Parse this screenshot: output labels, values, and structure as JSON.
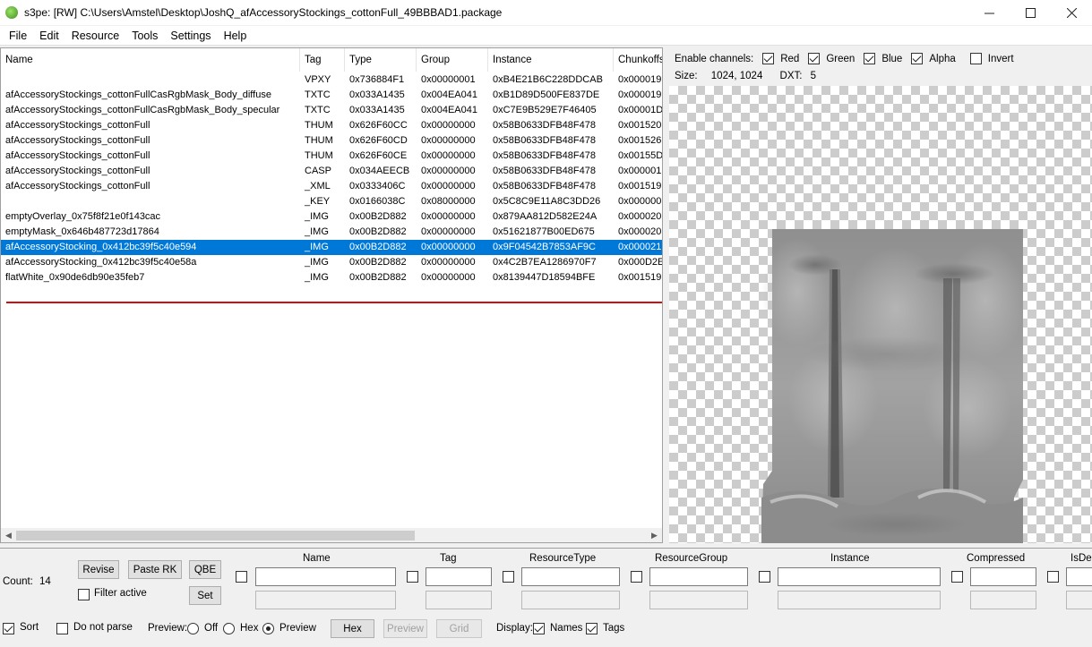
{
  "window": {
    "title": "s3pe: [RW] C:\\Users\\Amstel\\Desktop\\JoshQ_afAccessoryStockings_cottonFull_49BBBAD1.package"
  },
  "menu": [
    "File",
    "Edit",
    "Resource",
    "Tools",
    "Settings",
    "Help"
  ],
  "list": {
    "columns": [
      "Name",
      "Tag",
      "Type",
      "Group",
      "Instance",
      "Chunkoffs"
    ],
    "rows": [
      {
        "name": "",
        "tag": "VPXY",
        "type": "0x736884F1",
        "group": "0x00000001",
        "instance": "0xB4E21B6C228DDCAB",
        "chunk": "0x000019"
      },
      {
        "name": "afAccessoryStockings_cottonFullCasRgbMask_Body_diffuse",
        "tag": "TXTC",
        "type": "0x033A1435",
        "group": "0x004EA041",
        "instance": "0xB1D89D500FE837DE",
        "chunk": "0x000019"
      },
      {
        "name": "afAccessoryStockings_cottonFullCasRgbMask_Body_specular",
        "tag": "TXTC",
        "type": "0x033A1435",
        "group": "0x004EA041",
        "instance": "0xC7E9B529E7F46405",
        "chunk": "0x00001D"
      },
      {
        "name": "afAccessoryStockings_cottonFull",
        "tag": "THUM",
        "type": "0x626F60CC",
        "group": "0x00000000",
        "instance": "0x58B0633DFB48F478",
        "chunk": "0x001520"
      },
      {
        "name": "afAccessoryStockings_cottonFull",
        "tag": "THUM",
        "type": "0x626F60CD",
        "group": "0x00000000",
        "instance": "0x58B0633DFB48F478",
        "chunk": "0x001526"
      },
      {
        "name": "afAccessoryStockings_cottonFull",
        "tag": "THUM",
        "type": "0x626F60CE",
        "group": "0x00000000",
        "instance": "0x58B0633DFB48F478",
        "chunk": "0x00155D"
      },
      {
        "name": "afAccessoryStockings_cottonFull",
        "tag": "CASP",
        "type": "0x034AEECB",
        "group": "0x00000000",
        "instance": "0x58B0633DFB48F478",
        "chunk": "0x000001"
      },
      {
        "name": "afAccessoryStockings_cottonFull",
        "tag": "_XML",
        "type": "0x0333406C",
        "group": "0x00000000",
        "instance": "0x58B0633DFB48F478",
        "chunk": "0x001519"
      },
      {
        "name": "",
        "tag": "_KEY",
        "type": "0x0166038C",
        "group": "0x08000000",
        "instance": "0x5C8C9E11A8C3DD26",
        "chunk": "0x000000"
      },
      {
        "name": "emptyOverlay_0x75f8f21e0f143cac",
        "tag": "_IMG",
        "type": "0x00B2D882",
        "group": "0x00000000",
        "instance": "0x879AA812D582E24A",
        "chunk": "0x000020"
      },
      {
        "name": "emptyMask_0x646b487723d17864",
        "tag": "_IMG",
        "type": "0x00B2D882",
        "group": "0x00000000",
        "instance": "0x51621877B00ED675",
        "chunk": "0x000020"
      },
      {
        "name": "afAccessoryStocking_0x412bc39f5c40e594",
        "tag": "_IMG",
        "type": "0x00B2D882",
        "group": "0x00000000",
        "instance": "0x9F04542B7853AF9C",
        "chunk": "0x000021",
        "selected": true
      },
      {
        "name": "afAccessoryStocking_0x412bc39f5c40e58a",
        "tag": "_IMG",
        "type": "0x00B2D882",
        "group": "0x00000000",
        "instance": "0x4C2B7EA1286970F7",
        "chunk": "0x000D2E"
      },
      {
        "name": "flatWhite_0x90de6db90e35feb7",
        "tag": "_IMG",
        "type": "0x00B2D882",
        "group": "0x00000000",
        "instance": "0x8139447D18594BFE",
        "chunk": "0x001519"
      }
    ]
  },
  "preview": {
    "channels_label": "Enable channels:",
    "channels": [
      {
        "label": "Red",
        "checked": true
      },
      {
        "label": "Green",
        "checked": true
      },
      {
        "label": "Blue",
        "checked": true
      },
      {
        "label": "Alpha",
        "checked": true
      },
      {
        "label": "Invert",
        "checked": false
      }
    ],
    "size_label": "Size:",
    "size_value": "1024, 1024",
    "dxt_label": "DXT:",
    "dxt_value": "5"
  },
  "bottom": {
    "count_label": "Count:",
    "count_value": "14",
    "revise": "Revise",
    "paste_rk": "Paste RK",
    "qbe": "QBE",
    "filter_active": "Filter active",
    "set": "Set",
    "filter_columns": [
      "Name",
      "Tag",
      "ResourceType",
      "ResourceGroup",
      "Instance",
      "Compressed",
      "IsDel"
    ],
    "sort": "Sort",
    "do_not_parse": "Do not parse",
    "preview_label": "Preview:",
    "preview_off": "Off",
    "preview_hex": "Hex",
    "preview_preview": "Preview",
    "hex_btn": "Hex",
    "preview_btn": "Preview",
    "grid_btn": "Grid",
    "display_label": "Display:",
    "names": "Names",
    "tags": "Tags"
  },
  "colors": {
    "selection": "#0078d7",
    "highlight_line": "#d01010"
  }
}
